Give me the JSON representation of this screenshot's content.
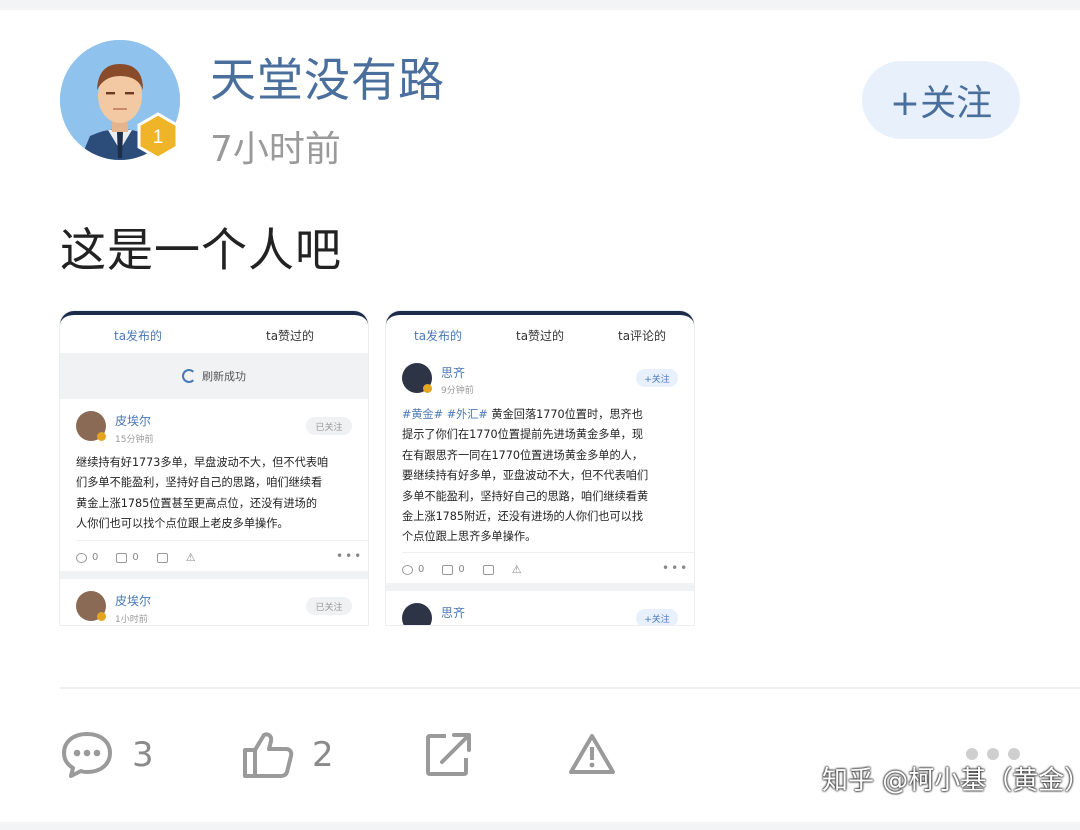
{
  "post": {
    "username": "天堂没有路",
    "time": "7小时前",
    "follow_label": "+关注",
    "badge_level": "1",
    "text": "这是一个人吧"
  },
  "shot1": {
    "tabs": [
      "ta发布的",
      "ta赞过的"
    ],
    "refresh": "刷新成功",
    "items": [
      {
        "name": "皮埃尔",
        "time": "15分钟前",
        "follow": "已关注",
        "lines": [
          "继续持有好1773多单，早盘波动不大，但不代表咱",
          "们多单不能盈利，坚持好自己的思路，咱们继续看",
          "黄金上涨1785位置甚至更高点位，还没有进场的",
          "人你们也可以找个点位跟上老皮多单操作。"
        ],
        "comments": "0",
        "likes": "0"
      },
      {
        "name": "皮埃尔",
        "time": "1小时前",
        "follow": "已关注"
      }
    ]
  },
  "shot2": {
    "tabs": [
      "ta发布的",
      "ta赞过的",
      "ta评论的"
    ],
    "items": [
      {
        "name": "思齐",
        "time": "9分钟前",
        "follow": "+关注",
        "tag1": "#黄金#",
        "tag2": "#外汇#",
        "lines": [
          "黄金回落1770位置时，思齐也",
          "提示了你们在1770位置提前先进场黄金多单，现",
          "在有跟思齐一同在1770位置进场黄金多单的人，",
          "要继续持有好多单，亚盘波动不大，但不代表咱们",
          "多单不能盈利，坚持好自己的思路，咱们继续看黄",
          "金上涨1785附近，还没有进场的人你们也可以找",
          "个点位跟上思齐多单操作。"
        ],
        "comments": "0",
        "likes": "0"
      },
      {
        "name": "思齐",
        "follow": "+关注"
      }
    ]
  },
  "footer": {
    "comments": "3",
    "likes": "2"
  },
  "watermark": "知乎 @柯小基（黄金）",
  "colors": {
    "accent": "#4a6f9c",
    "link": "#4a78b5",
    "follow_bg": "#e8f1fb",
    "badge": "#e3a51f"
  },
  "icons": [
    "comment-icon",
    "like-icon",
    "share-icon",
    "report-icon",
    "more-icon",
    "refresh-icon"
  ]
}
